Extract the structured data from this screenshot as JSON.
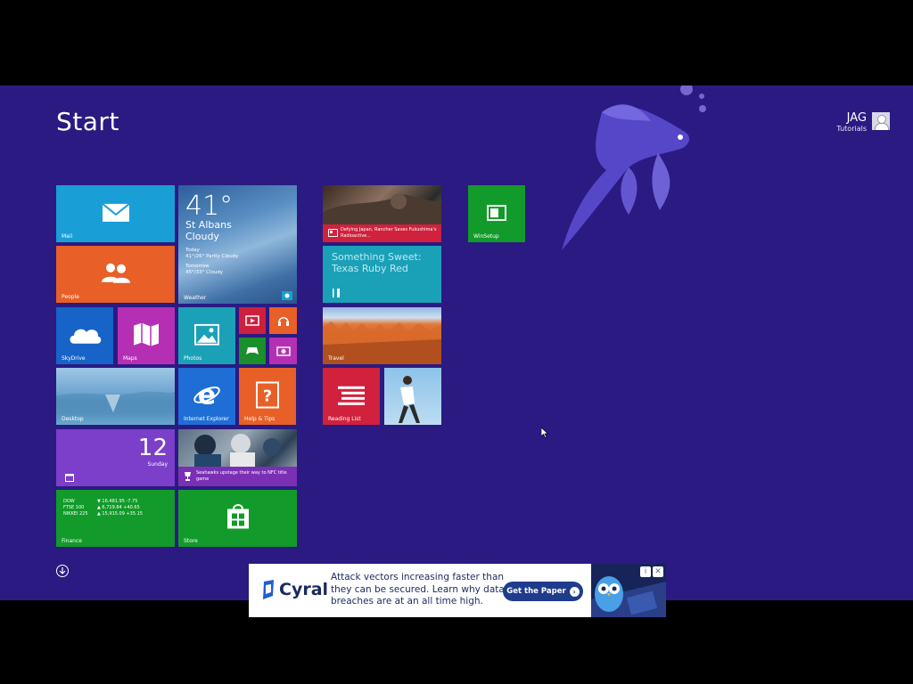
{
  "start": {
    "title": "Start"
  },
  "user": {
    "name": "JAG",
    "subtitle": "Tutorials"
  },
  "colors": {
    "background": "#2a1a82",
    "mail": "#1a9ed6",
    "people": "#e85f27",
    "skydrive": "#1763c7",
    "maps": "#b52fb5",
    "photos": "#1ba1b7",
    "video": "#cf1f3f",
    "music": "#e85f27",
    "games": "#1a8f2a",
    "camera": "#b52fb5",
    "ie": "#1e6ed6",
    "help": "#e85f27",
    "calendar": "#7b3fc9",
    "finance": "#129a2a",
    "store": "#129a2a",
    "food": "#1ba1b7",
    "reading": "#d0213d",
    "winsetup": "#129a2a"
  },
  "tiles": {
    "mail": {
      "label": "Mail",
      "icon": "mail-icon"
    },
    "weather": {
      "label": "Weather",
      "temp": "41°",
      "city": "St Albans",
      "condition": "Cloudy",
      "today_label": "Today",
      "today_fc": "41°/26° Partly Cloudy",
      "tomorrow_label": "Tomorrow",
      "tomorrow_fc": "45°/33° Cloudy"
    },
    "people": {
      "label": "People",
      "icon": "people-icon"
    },
    "skydrive": {
      "label": "SkyDrive",
      "icon": "cloud-icon"
    },
    "maps": {
      "label": "Maps",
      "icon": "map-icon"
    },
    "photos": {
      "label": "Photos",
      "icon": "photo-icon"
    },
    "video": {
      "icon": "video-icon"
    },
    "music": {
      "icon": "headphones-icon"
    },
    "games": {
      "icon": "gamepad-icon"
    },
    "camera": {
      "icon": "camera-icon"
    },
    "desktop": {
      "label": "Desktop"
    },
    "ie": {
      "label": "Internet Explorer",
      "icon": "ie-icon"
    },
    "help": {
      "label": "Help & Tips",
      "icon": "help-icon"
    },
    "calendar": {
      "day_number": "12",
      "day_name": "Sunday"
    },
    "sport": {
      "headline": "Seahawks upstage their way to NFC title game"
    },
    "finance": {
      "label": "Finance",
      "rows": [
        {
          "name": "DOW",
          "value": "▼ 16,481.95 -7.75"
        },
        {
          "name": "FTSE 100",
          "value": "▲ 6,719.84 +40.65"
        },
        {
          "name": "NIKKEI 225",
          "value": "▲ 15,915.09 +35.15"
        }
      ]
    },
    "store": {
      "label": "Store",
      "icon": "store-icon"
    },
    "news": {
      "headline": "Defying Japan, Rancher Saves Fukushima's Radioactive..."
    },
    "food": {
      "title": "Something Sweet: Texas Ruby Red"
    },
    "travel": {
      "label": "Travel"
    },
    "reading": {
      "label": "Reading List",
      "icon": "reading-list-icon"
    },
    "winsetup": {
      "label": "WinSetup",
      "icon": "winsetup-icon"
    }
  },
  "ad": {
    "brand": "Cyral",
    "copy": "Attack vectors increasing faster than they can be secured. Learn why data breaches are at an all time high.",
    "button": "Get the Paper",
    "info": "i",
    "close": "✕"
  }
}
